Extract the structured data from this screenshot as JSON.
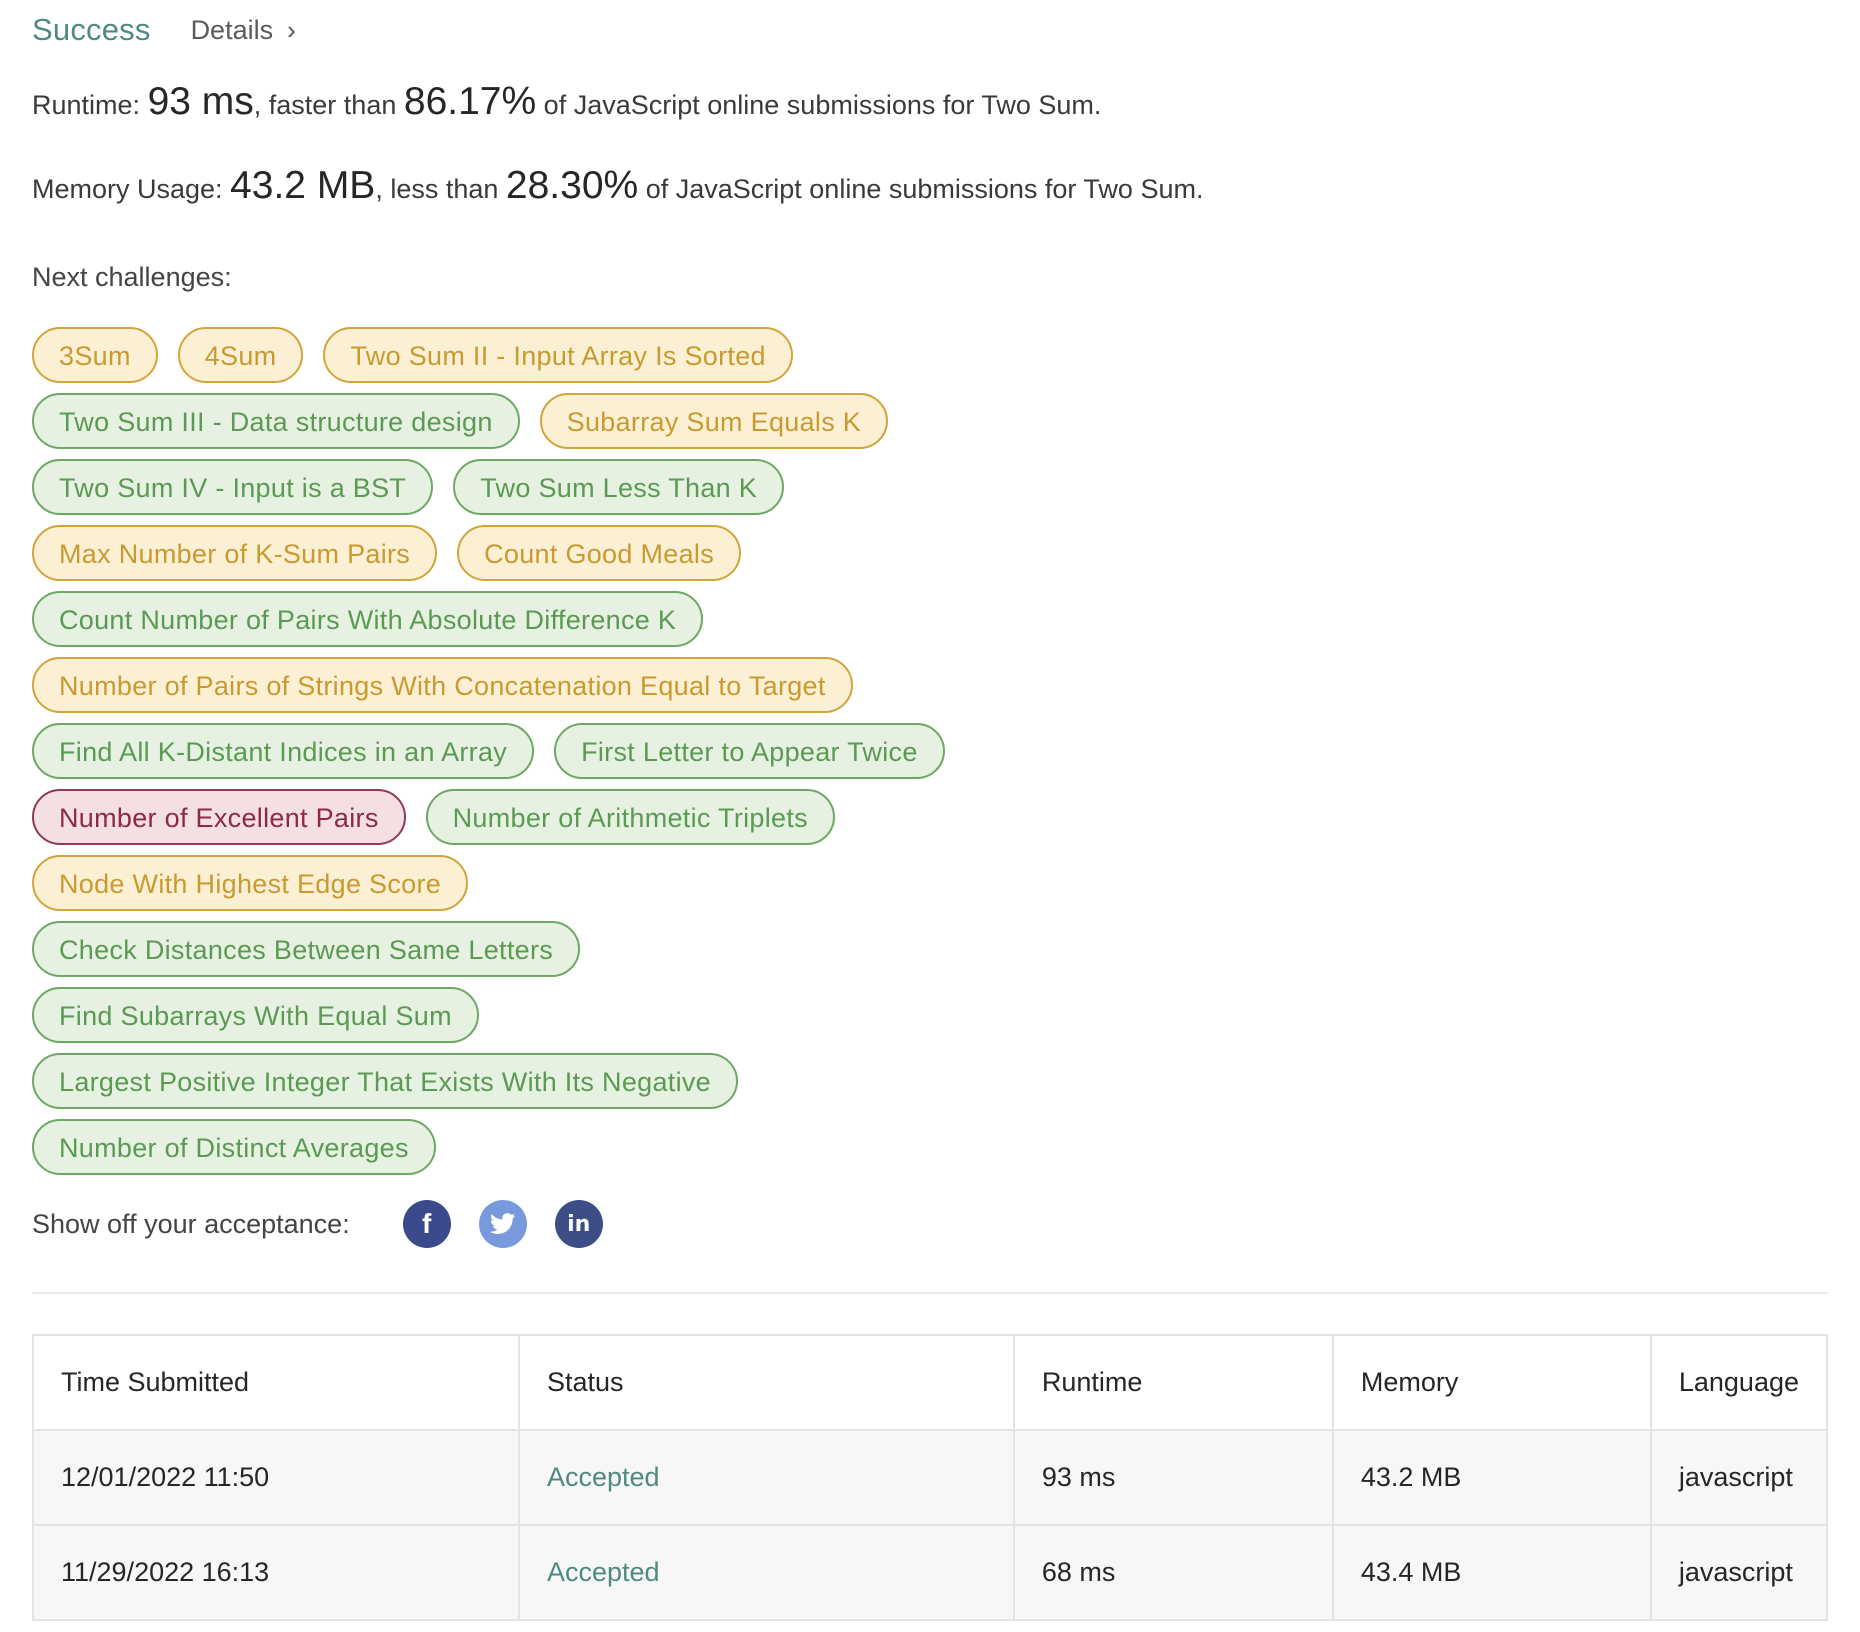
{
  "header": {
    "status": "Success",
    "details_label": "Details",
    "details_chevron": "›"
  },
  "runtime": {
    "label": "Runtime:",
    "value": "93 ms",
    "middle": ", faster than",
    "percent": "86.17%",
    "suffix": "of JavaScript online submissions for Two Sum."
  },
  "memory": {
    "label": "Memory Usage:",
    "value": "43.2 MB",
    "middle": ", less than",
    "percent": "28.30%",
    "suffix": "of JavaScript online submissions for Two Sum."
  },
  "next_challenges": {
    "label": "Next challenges:",
    "rows": [
      [
        {
          "label": "3Sum",
          "difficulty": "medium"
        },
        {
          "label": "4Sum",
          "difficulty": "medium"
        },
        {
          "label": "Two Sum II - Input Array Is Sorted",
          "difficulty": "medium"
        }
      ],
      [
        {
          "label": "Two Sum III - Data structure design",
          "difficulty": "easy"
        },
        {
          "label": "Subarray Sum Equals K",
          "difficulty": "medium"
        }
      ],
      [
        {
          "label": "Two Sum IV - Input is a BST",
          "difficulty": "easy"
        },
        {
          "label": "Two Sum Less Than K",
          "difficulty": "easy"
        }
      ],
      [
        {
          "label": "Max Number of K-Sum Pairs",
          "difficulty": "medium"
        },
        {
          "label": "Count Good Meals",
          "difficulty": "medium"
        }
      ],
      [
        {
          "label": "Count Number of Pairs With Absolute Difference K",
          "difficulty": "easy"
        }
      ],
      [
        {
          "label": "Number of Pairs of Strings With Concatenation Equal to Target",
          "difficulty": "medium"
        }
      ],
      [
        {
          "label": "Find All K-Distant Indices in an Array",
          "difficulty": "easy"
        },
        {
          "label": "First Letter to Appear Twice",
          "difficulty": "easy"
        }
      ],
      [
        {
          "label": "Number of Excellent Pairs",
          "difficulty": "hard"
        },
        {
          "label": "Number of Arithmetic Triplets",
          "difficulty": "easy"
        }
      ],
      [
        {
          "label": "Node With Highest Edge Score",
          "difficulty": "medium"
        }
      ],
      [
        {
          "label": "Check Distances Between Same Letters",
          "difficulty": "easy"
        }
      ],
      [
        {
          "label": "Find Subarrays With Equal Sum",
          "difficulty": "easy"
        }
      ],
      [
        {
          "label": "Largest Positive Integer That Exists With Its Negative",
          "difficulty": "easy"
        }
      ],
      [
        {
          "label": "Number of Distinct Averages",
          "difficulty": "easy"
        }
      ]
    ]
  },
  "colors": {
    "easy": "#5a9a52",
    "medium": "#c99a30",
    "hard": "#8c2a48",
    "accepted": "#4f8a82"
  },
  "share": {
    "label": "Show off your acceptance:",
    "icons": [
      {
        "name": "facebook-icon",
        "glyph": "f"
      },
      {
        "name": "twitter-icon",
        "glyph": "🐦"
      },
      {
        "name": "linkedin-icon",
        "glyph": "in"
      }
    ]
  },
  "submissions": {
    "headers": [
      "Time Submitted",
      "Status",
      "Runtime",
      "Memory",
      "Language"
    ],
    "rows": [
      {
        "time": "12/01/2022 11:50",
        "status": "Accepted",
        "runtime": "93 ms",
        "memory": "43.2 MB",
        "language": "javascript"
      },
      {
        "time": "11/29/2022 16:13",
        "status": "Accepted",
        "runtime": "68 ms",
        "memory": "43.4 MB",
        "language": "javascript"
      }
    ]
  }
}
